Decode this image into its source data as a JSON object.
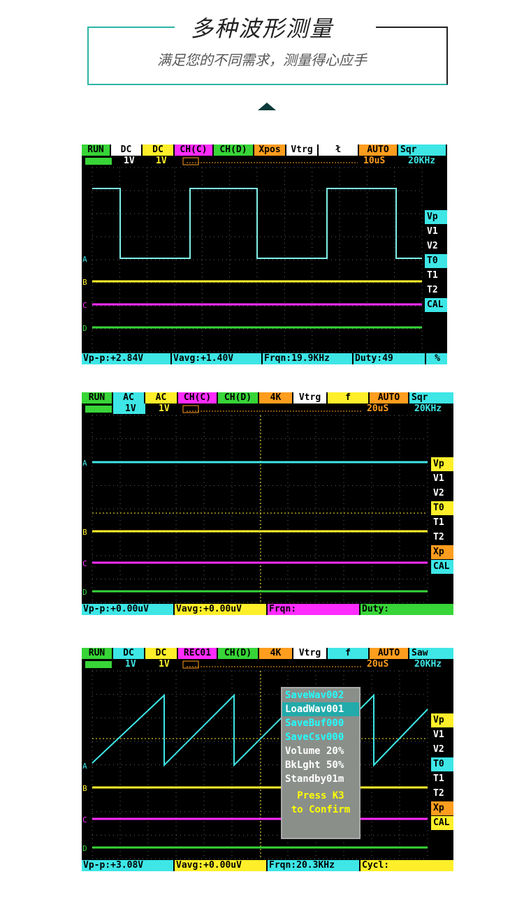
{
  "header": {
    "title": "多种波形测量",
    "subtitle": "满足您的不同需求，测量得心应手"
  },
  "colors": {
    "accent": "#2bb5a6",
    "cyan": "#3ee6e6",
    "yellow": "#ffef2a",
    "magenta": "#ff2cff",
    "green": "#37d537",
    "orange": "#ff9d1e"
  },
  "scope1": {
    "top": [
      "RUN",
      "DC",
      "DC",
      "CH(C)",
      "CH(D)",
      "Xpos",
      "Vtrg",
      "ł",
      "AUTO",
      "Sqr"
    ],
    "row2": {
      "ch1": "1V",
      "ch2": "1V",
      "timebase": "10uS",
      "freq": "20KHz"
    },
    "side": [
      "Vp",
      "V1",
      "V2",
      "T0",
      "T1",
      "T2",
      "CAL"
    ],
    "bottom": [
      "Vp-p:+2.84V",
      "Vavg:+1.40V",
      "Frqn:19.9KHz",
      "Duty:49",
      "%"
    ]
  },
  "scope2": {
    "top": [
      "RUN",
      "AC",
      "AC",
      "CH(C)",
      "CH(D)",
      "4K",
      "Vtrg",
      "f",
      "AUTO",
      "Sqr"
    ],
    "row2": {
      "ch1": "1V",
      "ch2": "1V",
      "timebase": "20uS",
      "freq": "20KHz"
    },
    "side": [
      "Vp",
      "V1",
      "V2",
      "T0",
      "T1",
      "T2",
      "Xp",
      "CAL"
    ],
    "bottom": [
      "Vp-p:+0.00uV",
      "Vavg:+0.00uV",
      "Frqn:",
      "Duty:"
    ]
  },
  "scope3": {
    "top": [
      "RUN",
      "DC",
      "DC",
      "REC01",
      "CH(D)",
      "4K",
      "Vtrg",
      "f",
      "AUTO",
      "Saw"
    ],
    "row2": {
      "ch1": "1V",
      "ch2": "1V",
      "timebase": "20uS",
      "freq": "20KHz"
    },
    "side": [
      "Vp",
      "V1",
      "V2",
      "T0",
      "T1",
      "T2",
      "Xp",
      "CAL"
    ],
    "bottom": [
      "Vp-p:+3.08V",
      "Vavg:+0.00uV",
      "Frqn:20.3KHz",
      "Cycl:"
    ],
    "menu": [
      "SaveWav002",
      "LoadWav001",
      "SaveBuf000",
      "SaveCsv000",
      "Volume 20%",
      "BkLght 50%",
      "Standby01m",
      "Press K3",
      "to Confirm"
    ]
  }
}
